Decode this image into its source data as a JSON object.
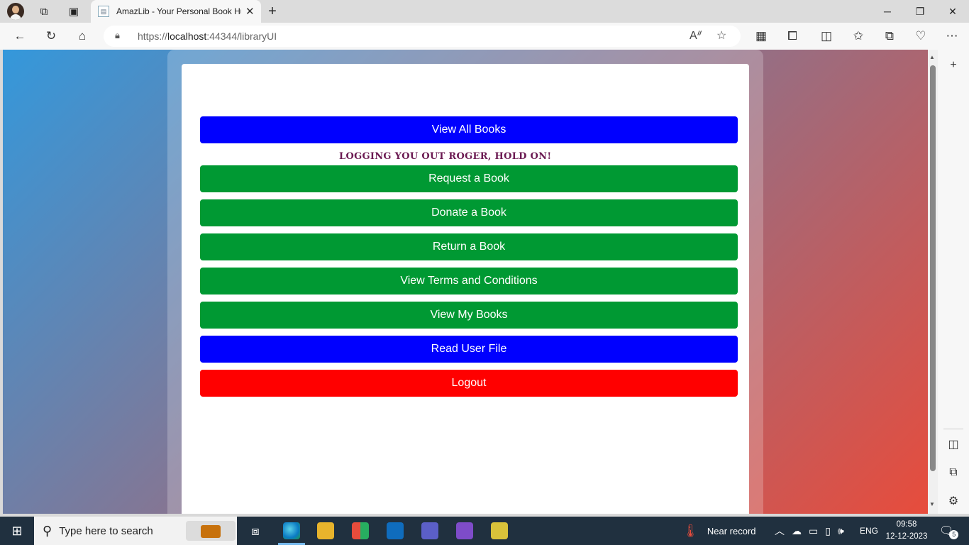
{
  "browser": {
    "tab_title": "AmazLib - Your Personal Book Hub",
    "url_prefix": "https://",
    "url_host": "localhost",
    "url_path": ":44344/libraryUI"
  },
  "page": {
    "status_message": "Logging you out Roger, hold on!",
    "buttons": [
      {
        "label": "View All Books",
        "color": "#0000ff"
      },
      {
        "label": "Request a Book",
        "color": "#009933"
      },
      {
        "label": "Donate a Book",
        "color": "#009933"
      },
      {
        "label": "Return a Book",
        "color": "#009933"
      },
      {
        "label": "View Terms and Conditions",
        "color": "#009933"
      },
      {
        "label": "View My Books",
        "color": "#009933"
      },
      {
        "label": "Read User File",
        "color": "#0000ff"
      },
      {
        "label": "Logout",
        "color": "#ff0000"
      }
    ],
    "status_color": "#6b1a52"
  },
  "taskbar": {
    "search_placeholder": "Type here to search",
    "weather": "Near record",
    "language": "ENG",
    "time": "09:58",
    "date": "12-12-2023",
    "notification_count": "5"
  }
}
